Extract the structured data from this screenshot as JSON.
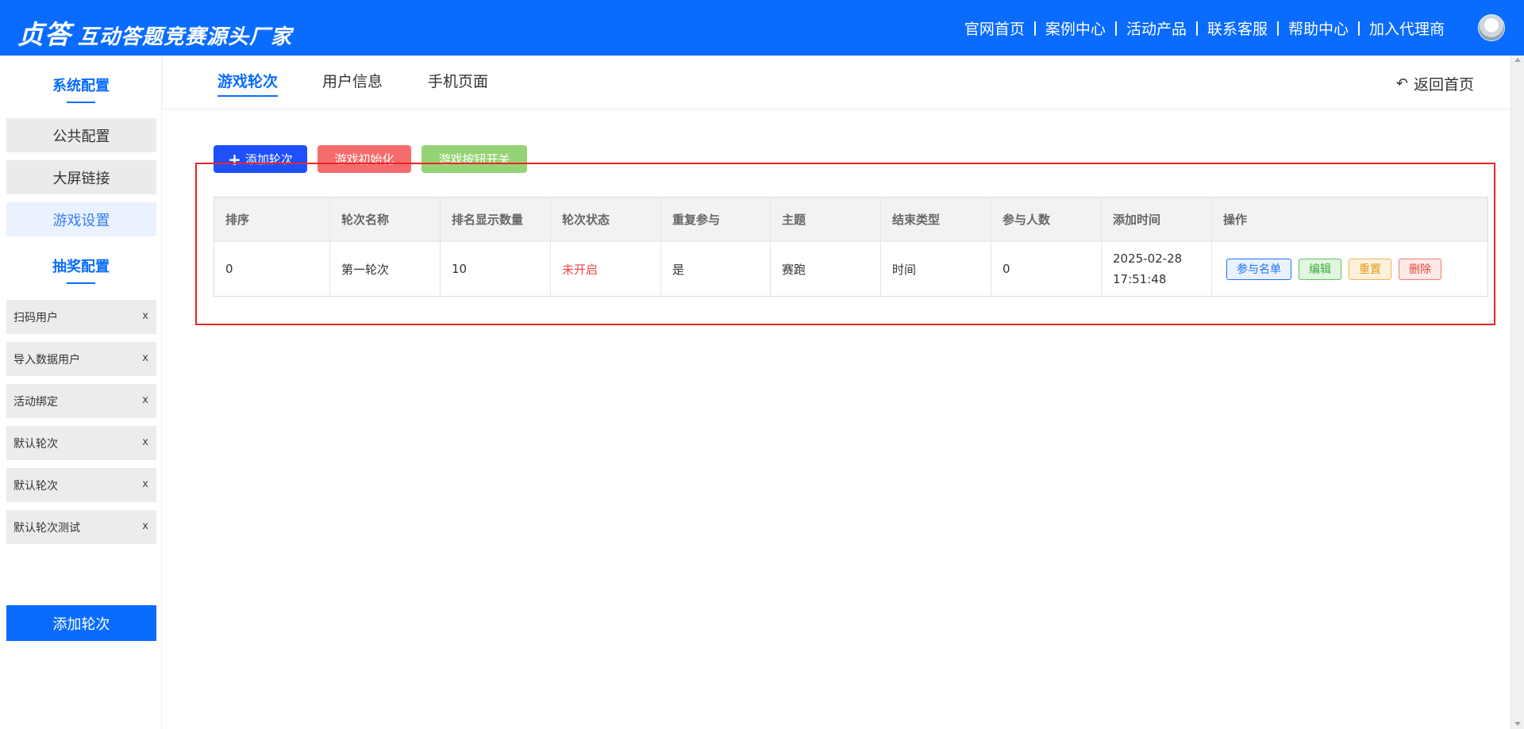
{
  "header": {
    "brand_logo": "贞答",
    "brand_slogan": "互动答题竞赛源头厂家",
    "nav": [
      "官网首页",
      "案例中心",
      "活动产品",
      "联系客服",
      "帮助中心",
      "加入代理商"
    ],
    "colors": {
      "primary": "#0a6cff"
    }
  },
  "sidebar": {
    "system_title": "系统配置",
    "system_items": [
      "公共配置",
      "大屏链接",
      "游戏设置"
    ],
    "active_item": "游戏设置",
    "lottery_title": "抽奖配置",
    "lottery_items": [
      "扫码用户",
      "导入数据用户",
      "活动绑定",
      "默认轮次",
      "默认轮次",
      "默认轮次测试"
    ],
    "close_glyph": "x",
    "add_button": "添加轮次"
  },
  "tabs": {
    "items": [
      "游戏轮次",
      "用户信息",
      "手机页面"
    ],
    "active": "游戏轮次",
    "back_home": "返回首页"
  },
  "actions": {
    "add_round": "添加轮次",
    "init_game": "游戏初始化",
    "toggle_button": "游戏按钮开关",
    "colors": {
      "add": "#1e50ff",
      "init": "#f56c6c",
      "toggle": "#95d475"
    }
  },
  "table": {
    "columns": [
      "排序",
      "轮次名称",
      "排名显示数量",
      "轮次状态",
      "重复参与",
      "主题",
      "结束类型",
      "参与人数",
      "添加时间",
      "操作"
    ],
    "rows": [
      {
        "order": "0",
        "name": "第一轮次",
        "rank_count": "10",
        "status": "未开启",
        "repeat": "是",
        "theme": "赛跑",
        "end_type": "时间",
        "participants": "0",
        "added_time": "2025-02-28 17:51:48",
        "ops": [
          "参与名单",
          "编辑",
          "重置",
          "删除"
        ]
      }
    ]
  }
}
